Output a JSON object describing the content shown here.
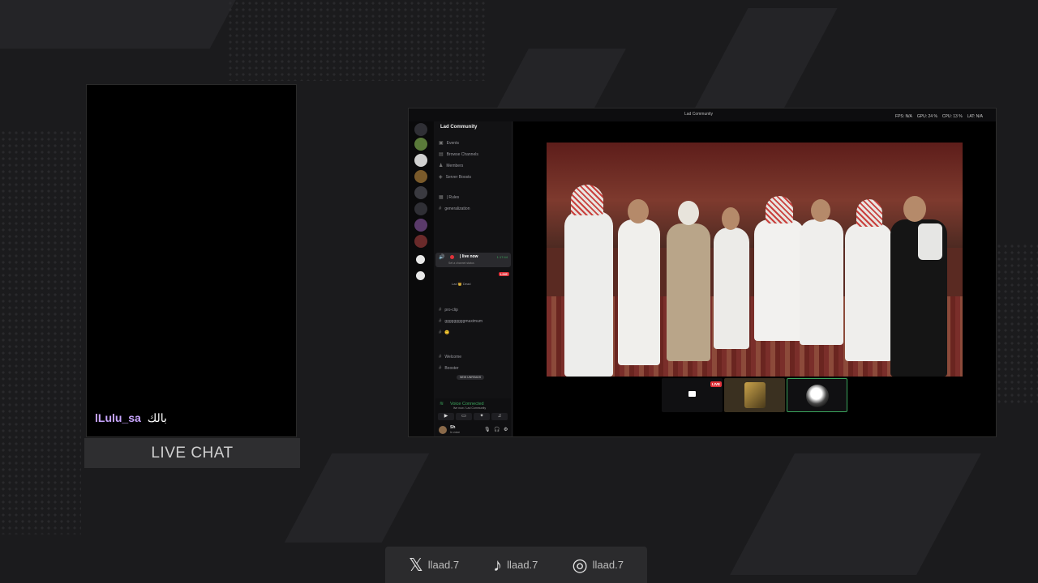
{
  "chat": {
    "username": "lLulu_sa",
    "message": "بالك",
    "footer_label": "LIVE CHAT"
  },
  "window": {
    "title": "Lad Community",
    "stats": {
      "fps": "FPS: N/A",
      "gpu": "GPU: 24 %",
      "cpu": "CPU: 13 %",
      "lat": "LAT: N/A"
    }
  },
  "discord": {
    "server_name": "Lad Community",
    "menu_items": [
      "Events",
      "Browse Channels",
      "Members",
      "Server Boosts"
    ],
    "channels": [
      "| Rules",
      "generalization"
    ],
    "live_channel": {
      "label": "| live now",
      "subtitle": "Set a channel status",
      "time": "1:17:44"
    },
    "live_badge": "LIVE",
    "user_in_channel": "Lad 👑 Dead",
    "channels_2": [
      "pro-clip",
      "gggggggggmaximum",
      "😊"
    ],
    "channels_3": [
      "Welcome",
      "Booster"
    ],
    "new_unreads": "NEW UNREADS",
    "voice": {
      "status": "Voice Connected",
      "subtitle": "live now / Lad Community"
    },
    "user": {
      "name": "Sh",
      "status": "In voice"
    }
  },
  "stream": {
    "live_tag": "LIVE"
  },
  "social": [
    {
      "icon": "x-logo-icon",
      "glyph": "𝕏",
      "handle": "llaad.7"
    },
    {
      "icon": "tiktok-icon",
      "glyph": "♪",
      "handle": "llaad.7"
    },
    {
      "icon": "instagram-icon",
      "glyph": "◎",
      "handle": "llaad.7"
    }
  ],
  "colors": {
    "background": "#1b1b1d",
    "username": "#c9a6ff",
    "voice_green": "#3ba55c",
    "live_red": "#e0323a"
  }
}
